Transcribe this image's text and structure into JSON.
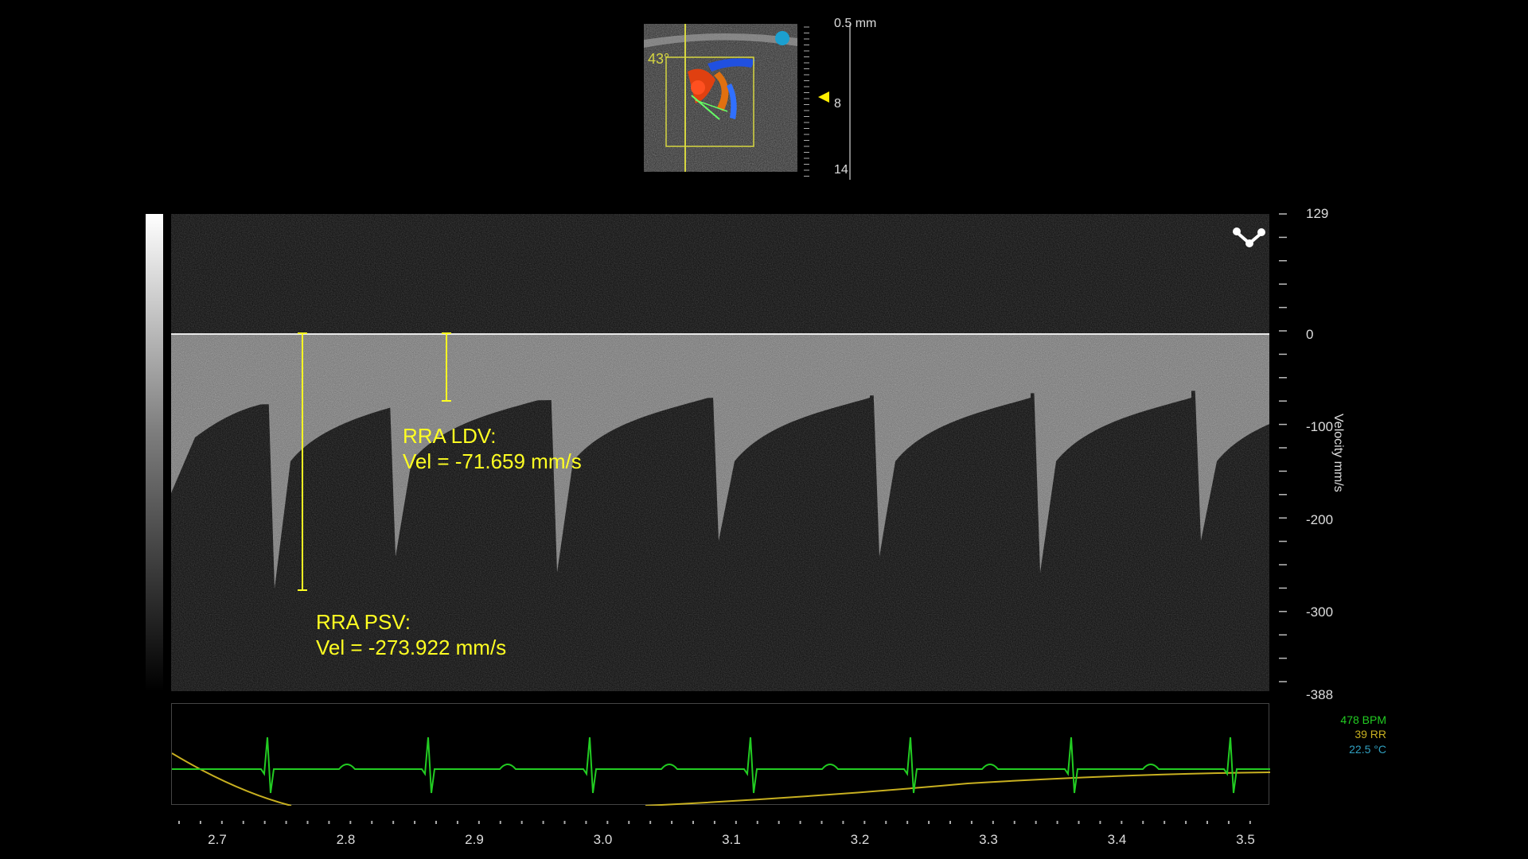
{
  "thumbnail": {
    "angle_label": "43°",
    "depth_top": "0.5 mm",
    "depth_mid": "8",
    "depth_bottom": "14",
    "colors": {
      "frame": "#d6d640",
      "marker": "#1ca0d0",
      "cursor": "#ffee00"
    }
  },
  "velocity_axis": {
    "title": "Velocity mm/s",
    "ticks": [
      "129",
      "0",
      "-100",
      "-200",
      "-300",
      "-388"
    ]
  },
  "measurements": {
    "ldv": {
      "line1": "RRA LDV:",
      "line2": "Vel = -71.659 mm/s"
    },
    "psv": {
      "line1": "RRA PSV:",
      "line2": "Vel = -273.922 mm/s"
    },
    "color": "#ffff22"
  },
  "physio": {
    "bpm": "478 BPM",
    "rr": "39 RR",
    "temp": "22.5 °C",
    "colors": {
      "ecg": "#22cc22",
      "resp": "#c8b020",
      "temp": "#30a0c0"
    }
  },
  "time_axis": {
    "labels": [
      "2.7",
      "2.8",
      "2.9",
      "3.0",
      "3.1",
      "3.2",
      "3.3",
      "3.4",
      "3.5"
    ]
  },
  "tool_icon": "measure-tool-icon"
}
